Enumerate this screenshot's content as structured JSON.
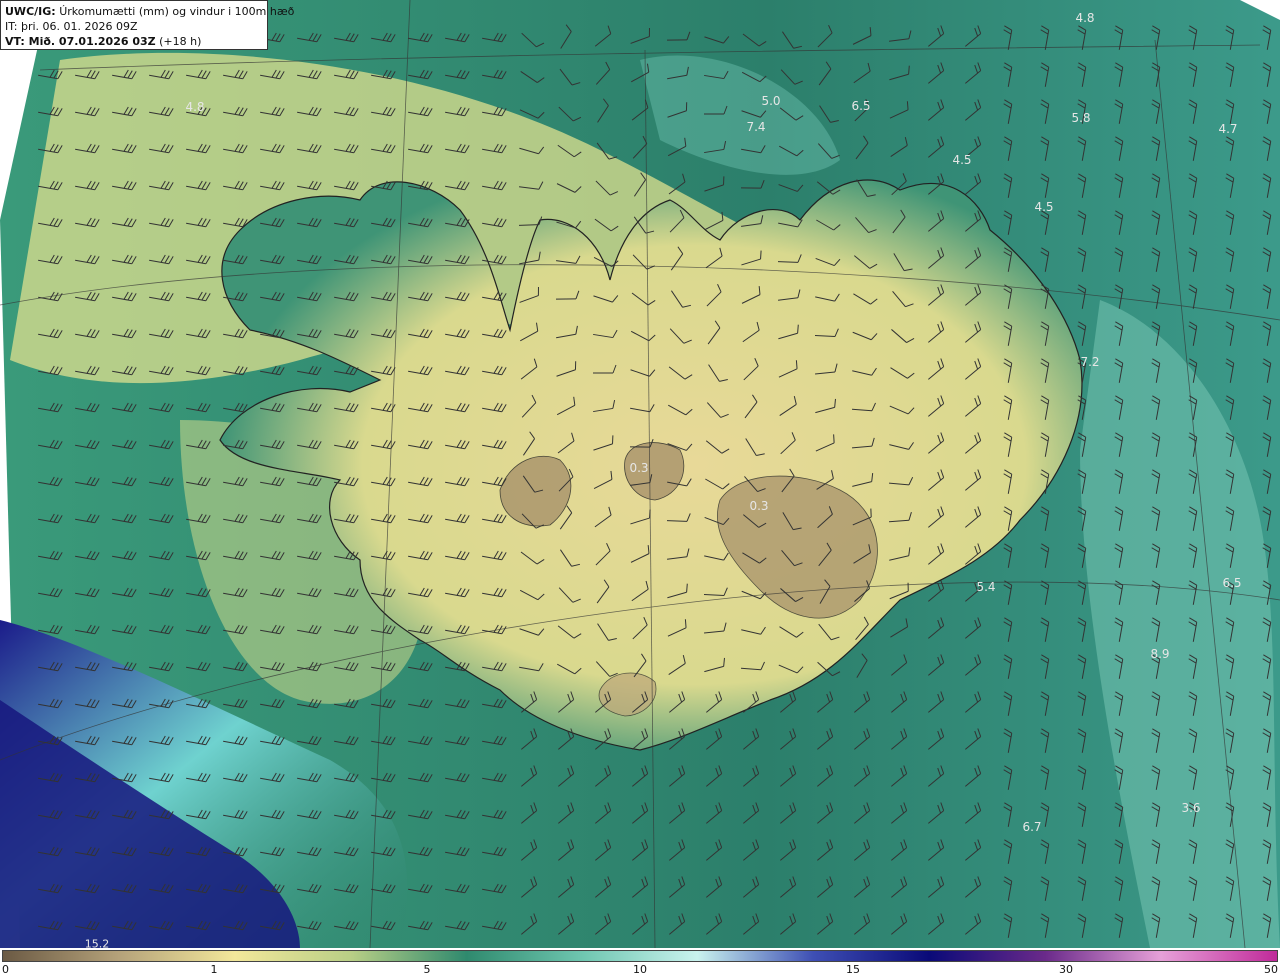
{
  "header": {
    "line1_bold": "UWC/IG:",
    "line1_text": "Úrkomumætti (mm) og vindur i 100m hæð",
    "line2": "IT: þri. 06. 01. 2026 09Z",
    "line3_bold": "VT: Mið. 07.01.2026 03Z",
    "line3_text": "(+18 h)"
  },
  "value_labels": [
    "4.8",
    "4.8",
    "5.0",
    "6.5",
    "7.4",
    "5.8",
    "4.7",
    "4.5",
    "4.5",
    "7.2",
    "0.3",
    "0.3",
    "5.4",
    "6.5",
    "8.9",
    "3.6",
    "6.7",
    "15.2"
  ],
  "colorbar": {
    "ticks": [
      "0",
      "1",
      "5",
      "10",
      "15",
      "30",
      "50"
    ],
    "colors": [
      "#6b5a44",
      "#b5a27a",
      "#f2e79a",
      "#b9cf86",
      "#2f8a6e",
      "#6fc6b0",
      "#c9f2ee",
      "#3e4fb4",
      "#0a0a78",
      "#6a2a8a",
      "#e6a0d8",
      "#c02a9a"
    ]
  },
  "map_colors": {
    "dry": "#a8936b",
    "light": "#eee39a",
    "moderate": "#2c7f6b",
    "heavy": "#8fd6cc",
    "extreme": "#0a0a7a"
  }
}
